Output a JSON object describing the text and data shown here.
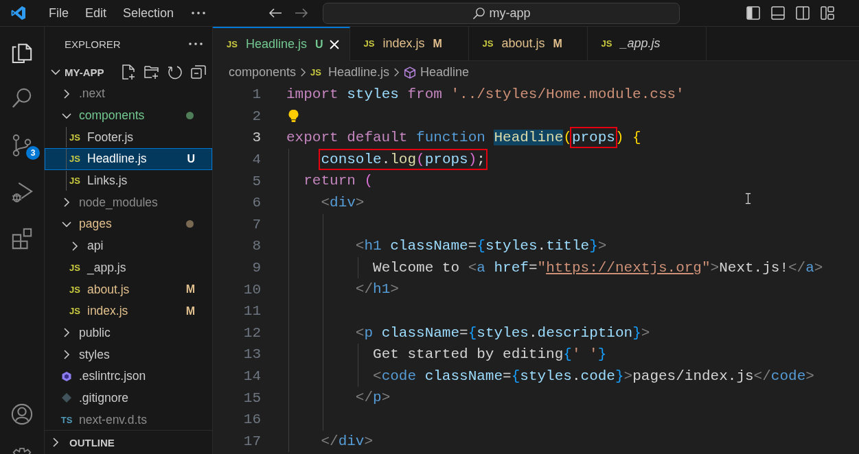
{
  "title_bar": {
    "menus": [
      {
        "label": "File"
      },
      {
        "label": "Edit"
      },
      {
        "label": "Selection"
      }
    ],
    "command_center": {
      "text": "my-app"
    }
  },
  "activity_bar": {
    "items": [
      {
        "kind": "explorer",
        "selected": true
      },
      {
        "kind": "search",
        "selected": false
      },
      {
        "kind": "source-control",
        "selected": false,
        "badge": "3"
      },
      {
        "kind": "run-debug",
        "selected": false
      },
      {
        "kind": "extensions",
        "selected": false
      }
    ],
    "bottom": [
      {
        "kind": "account"
      },
      {
        "kind": "settings"
      }
    ]
  },
  "sidebar": {
    "title": "EXPLORER",
    "root": {
      "label": "MY-APP",
      "expanded": true,
      "children": [
        {
          "label": ".next",
          "kind": "folder",
          "expanded": false,
          "color": "#8c8c8c",
          "selected": false
        },
        {
          "label": "components",
          "kind": "folder",
          "expanded": true,
          "color": "#73c991",
          "dot": {
            "color": "#4e7d57"
          },
          "selected": false,
          "children": [
            {
              "label": "Footer.js",
              "kind": "file",
              "icon": {
                "kind": "text",
                "text": "JS"
              },
              "color": "#cccccc",
              "selected": false
            },
            {
              "label": "Headline.js",
              "kind": "file",
              "icon": {
                "kind": "text",
                "text": "JS"
              },
              "badge": "U",
              "selected": true
            },
            {
              "label": "Links.js",
              "kind": "file",
              "icon": {
                "kind": "text",
                "text": "JS"
              },
              "color": "#cccccc",
              "selected": false
            }
          ]
        },
        {
          "label": "node_modules",
          "kind": "folder",
          "expanded": false,
          "color": "#8c8c8c",
          "selected": false
        },
        {
          "label": "pages",
          "kind": "folder",
          "expanded": true,
          "color": "#e2c08d",
          "dot": {
            "color": "#7a6a52"
          },
          "selected": false,
          "children": [
            {
              "label": "api",
              "kind": "folder",
              "expanded": false,
              "color": "#cccccc",
              "selected": false
            },
            {
              "label": "_app.js",
              "kind": "file",
              "icon": {
                "kind": "text",
                "text": "JS"
              },
              "color": "#cccccc",
              "selected": false
            },
            {
              "label": "about.js",
              "kind": "file",
              "icon": {
                "kind": "text",
                "text": "JS"
              },
              "color": "#e2c08d",
              "badge": "M",
              "selected": false
            },
            {
              "label": "index.js",
              "kind": "file",
              "icon": {
                "kind": "text",
                "text": "JS"
              },
              "color": "#e2c08d",
              "badge": "M",
              "selected": false
            }
          ]
        },
        {
          "label": "public",
          "kind": "folder",
          "expanded": false,
          "color": "#cccccc",
          "selected": false
        },
        {
          "label": "styles",
          "kind": "folder",
          "expanded": false,
          "color": "#cccccc",
          "selected": false
        },
        {
          "label": ".eslintrc.json",
          "kind": "file",
          "icon": {
            "kind": "eslint"
          },
          "color": "#cccccc",
          "selected": false
        },
        {
          "label": ".gitignore",
          "kind": "file",
          "icon": {
            "kind": "git"
          },
          "color": "#cccccc",
          "selected": false
        },
        {
          "label": "next-env.d.ts",
          "kind": "file",
          "icon": {
            "kind": "text",
            "text": "TS"
          },
          "color": "#8c8c8c",
          "selected": false
        }
      ]
    },
    "outline": {
      "label": "OUTLINE",
      "expanded": false
    }
  },
  "tabs": [
    {
      "label": "Headline.js",
      "icon_text": "JS",
      "color": "#73c991",
      "badge": "U",
      "selected": true,
      "preview": false
    },
    {
      "label": "index.js",
      "icon_text": "JS",
      "color": "#e2c08d",
      "badge": "M",
      "selected": false,
      "preview": false
    },
    {
      "label": "about.js",
      "icon_text": "JS",
      "color": "#e2c08d",
      "badge": "M",
      "selected": false,
      "preview": false
    },
    {
      "label": "_app.js",
      "icon_text": "JS",
      "color": "#cccccc",
      "selected": false,
      "preview": true
    }
  ],
  "breadcrumb": [
    {
      "label": "components",
      "kind": "folder"
    },
    {
      "label": "Headline.js",
      "kind": "file",
      "icon_text": "JS"
    },
    {
      "label": "Headline",
      "kind": "symbol"
    }
  ],
  "code": [
    {
      "number": "1",
      "current": false,
      "tokens": [
        {
          "text": "import ",
          "kind": "keyword"
        },
        {
          "text": "styles ",
          "kind": "var"
        },
        {
          "text": "from ",
          "kind": "keyword"
        },
        {
          "text": "'../styles/Home.module.css'",
          "kind": "string"
        }
      ]
    },
    {
      "number": "2",
      "current": false,
      "lightbulb": true
    },
    {
      "number": "3",
      "current": true,
      "tokens": [
        {
          "text": "export default ",
          "kind": "keyword"
        },
        {
          "text": "function ",
          "kind": "storage"
        },
        {
          "text": "Headline",
          "kind": "func",
          "highlighted": true
        },
        {
          "text": "(",
          "kind": "b1"
        },
        {
          "kind": "group",
          "boxed": true,
          "tokens": [
            {
              "text": "props",
              "kind": "var"
            }
          ]
        },
        {
          "text": ")",
          "kind": "b1"
        },
        {
          "text": " {",
          "kind": "b1"
        }
      ]
    },
    {
      "number": "4",
      "current": false,
      "tokens": [
        {
          "kind": "group",
          "boxed": true,
          "tokens": [
            {
              "text": "    console",
              "kind": "var"
            },
            {
              "text": ".",
              "kind": "punct"
            },
            {
              "text": "log",
              "kind": "func"
            },
            {
              "text": "(",
              "kind": "b2"
            },
            {
              "text": "props",
              "kind": "var"
            },
            {
              "text": ")",
              "kind": "b2"
            },
            {
              "text": ";",
              "kind": "punct"
            }
          ]
        }
      ]
    },
    {
      "number": "5",
      "current": false,
      "tokens": [
        {
          "text": "  return ",
          "kind": "keyword"
        },
        {
          "text": "(",
          "kind": "b2"
        }
      ]
    },
    {
      "number": "6",
      "current": false,
      "tokens": [
        {
          "text": "    <",
          "kind": "tagp"
        },
        {
          "text": "div",
          "kind": "tag"
        },
        {
          "text": ">",
          "kind": "tagp"
        }
      ]
    },
    {
      "number": "7",
      "current": false
    },
    {
      "number": "8",
      "current": false,
      "tokens": [
        {
          "text": "        <",
          "kind": "tagp"
        },
        {
          "text": "h1 ",
          "kind": "tag"
        },
        {
          "text": "className",
          "kind": "var"
        },
        {
          "text": "=",
          "kind": "punct"
        },
        {
          "text": "{",
          "kind": "b3"
        },
        {
          "text": "styles",
          "kind": "var"
        },
        {
          "text": ".",
          "kind": "punct"
        },
        {
          "text": "title",
          "kind": "var"
        },
        {
          "text": "}",
          "kind": "b3"
        },
        {
          "text": ">",
          "kind": "tagp"
        }
      ]
    },
    {
      "number": "9",
      "current": false,
      "tokens": [
        {
          "text": "          Welcome to ",
          "kind": "text"
        },
        {
          "text": "<",
          "kind": "tagp"
        },
        {
          "text": "a ",
          "kind": "tag"
        },
        {
          "text": "href",
          "kind": "var"
        },
        {
          "text": "=",
          "kind": "punct"
        },
        {
          "text": "\"",
          "kind": "string"
        },
        {
          "text": "https://nextjs.org",
          "kind": "url"
        },
        {
          "text": "\"",
          "kind": "string"
        },
        {
          "text": ">",
          "kind": "tagp"
        },
        {
          "text": "Next.js!",
          "kind": "text"
        },
        {
          "text": "</",
          "kind": "tagp"
        },
        {
          "text": "a",
          "kind": "tag"
        },
        {
          "text": ">",
          "kind": "tagp"
        }
      ]
    },
    {
      "number": "10",
      "current": false,
      "tokens": [
        {
          "text": "        </",
          "kind": "tagp"
        },
        {
          "text": "h1",
          "kind": "tag"
        },
        {
          "text": ">",
          "kind": "tagp"
        }
      ]
    },
    {
      "number": "11",
      "current": false
    },
    {
      "number": "12",
      "current": false,
      "tokens": [
        {
          "text": "        <",
          "kind": "tagp"
        },
        {
          "text": "p ",
          "kind": "tag"
        },
        {
          "text": "className",
          "kind": "var"
        },
        {
          "text": "=",
          "kind": "punct"
        },
        {
          "text": "{",
          "kind": "b3"
        },
        {
          "text": "styles",
          "kind": "var"
        },
        {
          "text": ".",
          "kind": "punct"
        },
        {
          "text": "description",
          "kind": "var"
        },
        {
          "text": "}",
          "kind": "b3"
        },
        {
          "text": ">",
          "kind": "tagp"
        }
      ]
    },
    {
      "number": "13",
      "current": false,
      "tokens": [
        {
          "text": "          Get started by editing",
          "kind": "text"
        },
        {
          "text": "{",
          "kind": "b3"
        },
        {
          "text": "' '",
          "kind": "string"
        },
        {
          "text": "}",
          "kind": "b3"
        }
      ]
    },
    {
      "number": "14",
      "current": false,
      "tokens": [
        {
          "text": "          <",
          "kind": "tagp"
        },
        {
          "text": "code ",
          "kind": "tag"
        },
        {
          "text": "className",
          "kind": "var"
        },
        {
          "text": "=",
          "kind": "punct"
        },
        {
          "text": "{",
          "kind": "b3"
        },
        {
          "text": "styles",
          "kind": "var"
        },
        {
          "text": ".",
          "kind": "punct"
        },
        {
          "text": "code",
          "kind": "var"
        },
        {
          "text": "}",
          "kind": "b3"
        },
        {
          "text": ">",
          "kind": "tagp"
        },
        {
          "text": "pages/index.js",
          "kind": "text"
        },
        {
          "text": "</",
          "kind": "tagp"
        },
        {
          "text": "code",
          "kind": "tag"
        },
        {
          "text": ">",
          "kind": "tagp"
        }
      ]
    },
    {
      "number": "15",
      "current": false,
      "tokens": [
        {
          "text": "        </",
          "kind": "tagp"
        },
        {
          "text": "p",
          "kind": "tag"
        },
        {
          "text": ">",
          "kind": "tagp"
        }
      ]
    },
    {
      "number": "16",
      "current": false
    },
    {
      "number": "17",
      "current": false,
      "tokens": [
        {
          "text": "    </",
          "kind": "tagp"
        },
        {
          "text": "div",
          "kind": "tag"
        },
        {
          "text": ">",
          "kind": "tagp"
        }
      ]
    }
  ]
}
